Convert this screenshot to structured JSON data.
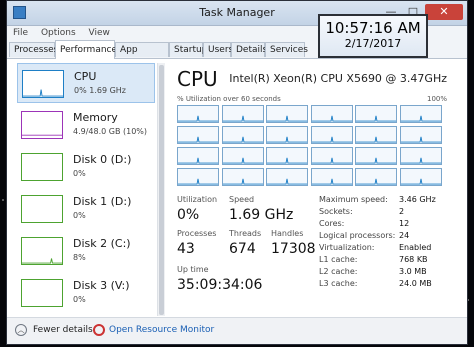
{
  "window": {
    "title": "Task Manager",
    "minimize": "—",
    "maximize": "□",
    "close": "✕"
  },
  "menu": [
    "File",
    "Options",
    "View"
  ],
  "tabs": [
    "Processes",
    "Performance",
    "App history",
    "Startup",
    "Users",
    "Details",
    "Services"
  ],
  "active_tab": "Performance",
  "sidebar": {
    "items": [
      {
        "name": "CPU",
        "sub": "0% 1.69 GHz",
        "color": "#1e7fc6",
        "selected": true
      },
      {
        "name": "Memory",
        "sub": "4.9/48.0 GB (10%)",
        "color": "#9c34b8",
        "selected": false
      },
      {
        "name": "Disk 0 (D:)",
        "sub": "0%",
        "color": "#4da330",
        "selected": false
      },
      {
        "name": "Disk 1 (D:)",
        "sub": "0%",
        "color": "#4da330",
        "selected": false
      },
      {
        "name": "Disk 2 (C:)",
        "sub": "8%",
        "color": "#4da330",
        "selected": false
      },
      {
        "name": "Disk 3 (V:)",
        "sub": "0%",
        "color": "#4da330",
        "selected": false
      }
    ]
  },
  "cpu": {
    "title": "CPU",
    "model": "Intel(R) Xeon(R) CPU X5690 @ 3.47GHz",
    "graph_label": "% Utilization over 60 seconds",
    "graph_max": "100%",
    "core_count_graphs": 24
  },
  "stats": {
    "utilization_label": "Utilization",
    "utilization": "0%",
    "speed_label": "Speed",
    "speed": "1.69 GHz",
    "processes_label": "Processes",
    "processes": "43",
    "threads_label": "Threads",
    "threads": "674",
    "handles_label": "Handles",
    "handles": "17308",
    "uptime_label": "Up time",
    "uptime": "35:09:34:06"
  },
  "specs": [
    {
      "key": "Maximum speed:",
      "value": "3.46 GHz"
    },
    {
      "key": "Sockets:",
      "value": "2"
    },
    {
      "key": "Cores:",
      "value": "12"
    },
    {
      "key": "Logical processors:",
      "value": "24"
    },
    {
      "key": "Virtualization:",
      "value": "Enabled"
    },
    {
      "key": "L1 cache:",
      "value": "768 KB"
    },
    {
      "key": "L2 cache:",
      "value": "3.0 MB"
    },
    {
      "key": "L3 cache:",
      "value": "24.0 MB"
    }
  ],
  "footer": {
    "fewer_details": "Fewer details",
    "open_resource_monitor": "Open Resource Monitor"
  },
  "clock": {
    "time": "10:57:16 AM",
    "date": "2/17/2017"
  }
}
